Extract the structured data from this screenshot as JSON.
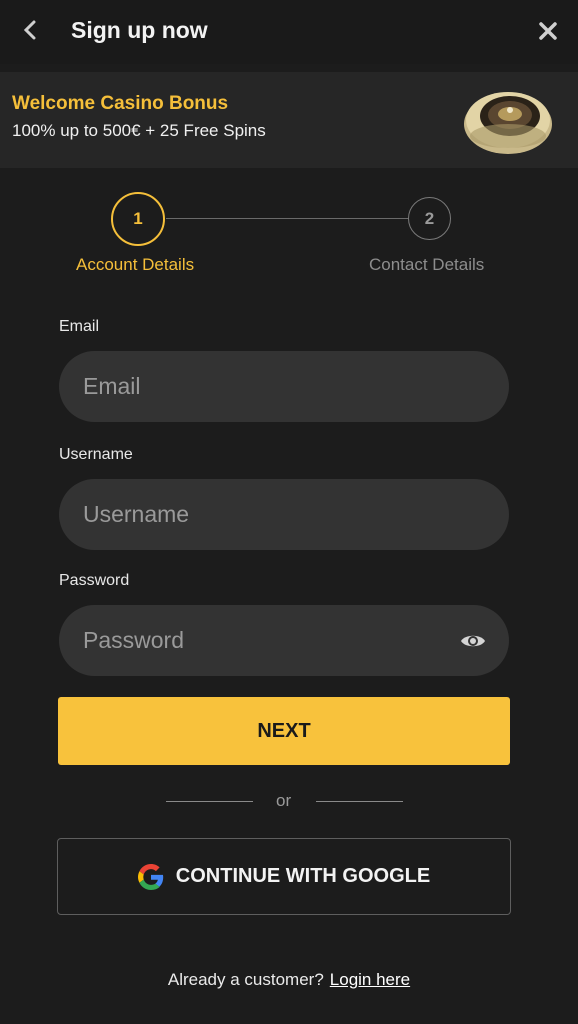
{
  "header": {
    "title": "Sign up now"
  },
  "promo": {
    "title": "Welcome Casino Bonus",
    "subtitle": "100% up to 500€ + 25 Free Spins"
  },
  "stepper": {
    "steps": [
      {
        "number": "1",
        "label": "Account Details",
        "active": true
      },
      {
        "number": "2",
        "label": "Contact Details",
        "active": false
      }
    ]
  },
  "form": {
    "email": {
      "label": "Email",
      "placeholder": "Email",
      "value": ""
    },
    "username": {
      "label": "Username",
      "placeholder": "Username",
      "value": ""
    },
    "password": {
      "label": "Password",
      "placeholder": "Password",
      "value": ""
    }
  },
  "actions": {
    "next_label": "NEXT",
    "or_label": "or",
    "google_label": "CONTINUE WITH GOOGLE"
  },
  "footer": {
    "text": "Already a customer?",
    "link": "Login here"
  },
  "colors": {
    "accent": "#f8c23c",
    "background": "#1c1c1c",
    "input": "#333333"
  },
  "icons": [
    "chevron-left-icon",
    "close-icon",
    "eye-icon",
    "google-icon",
    "roulette-wheel-icon"
  ]
}
